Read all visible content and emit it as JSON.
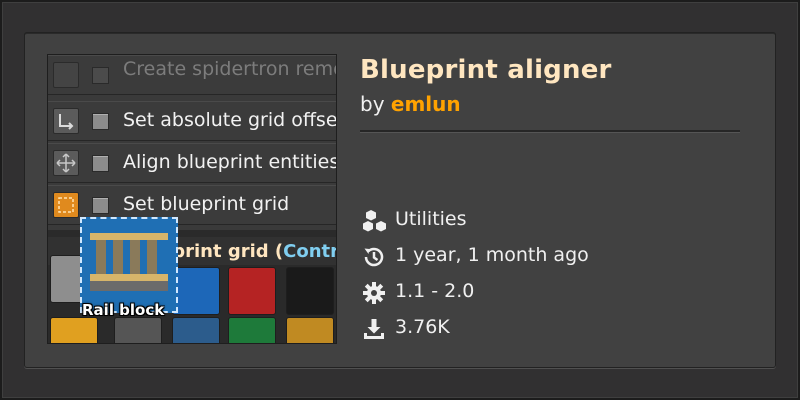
{
  "thumbnail": {
    "menu_items": [
      {
        "label": "Create spidertron remote",
        "faded": true
      },
      {
        "label": "Set absolute grid offset",
        "faded": false
      },
      {
        "label": "Align blueprint entities",
        "faded": false
      },
      {
        "label": "Set blueprint grid",
        "faded": false
      }
    ],
    "grid_title": "eprint grid (",
    "grid_title_ctrl": "Contro",
    "rail_label": "Rail block"
  },
  "mod": {
    "title": "Blueprint aligner",
    "by_prefix": "by ",
    "author": "emlun"
  },
  "meta": {
    "category": "Utilities",
    "updated": "1 year, 1 month ago",
    "version": "1.1 - 2.0",
    "downloads": "3.76K"
  },
  "colors": {
    "title": "#ffe6c0",
    "author": "#ffa200",
    "card_bg": "#414141"
  }
}
